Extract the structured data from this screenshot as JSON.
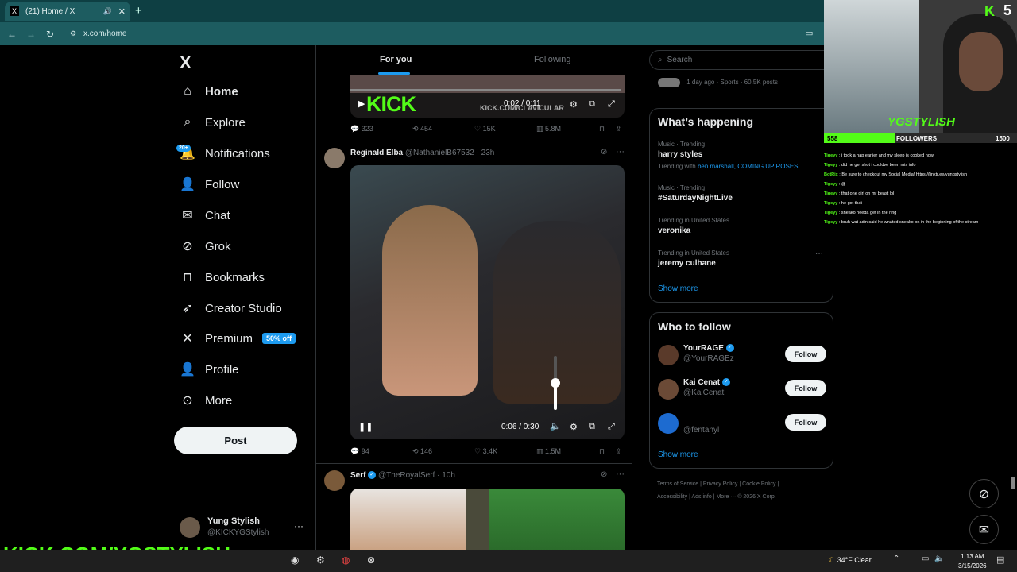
{
  "browser": {
    "tab_title": "(21) Home / X",
    "tab_favicon": "X",
    "url": "x.com/home",
    "new_tab": "+"
  },
  "nav": {
    "logo": "X",
    "items": [
      {
        "label": "Home",
        "icon": "home-icon"
      },
      {
        "label": "Explore",
        "icon": "search-icon"
      },
      {
        "label": "Notifications",
        "icon": "bell-icon",
        "badge": "20+"
      },
      {
        "label": "Follow",
        "icon": "add-person-icon"
      },
      {
        "label": "Chat",
        "icon": "mail-icon"
      },
      {
        "label": "Grok",
        "icon": "grok-icon"
      },
      {
        "label": "Bookmarks",
        "icon": "bookmark-icon"
      },
      {
        "label": "Creator Studio",
        "icon": "rocket-icon"
      },
      {
        "label": "Premium",
        "icon": "x-icon",
        "promo": "50% off"
      },
      {
        "label": "Profile",
        "icon": "person-icon"
      },
      {
        "label": "More",
        "icon": "more-circle-icon"
      }
    ],
    "post_label": "Post",
    "account_name": "Yung Stylish",
    "account_handle": "@KICKYGStylish",
    "account_more": "···"
  },
  "timeline": {
    "tab_for_you": "For you",
    "tab_following": "Following",
    "tweet1": {
      "video_time": "0:02 / 0:11",
      "watermark": "KICK.COM/CLAVICULAR",
      "kick_logo": "KICK",
      "replies": "323",
      "reposts": "454",
      "likes": "15K",
      "views": "5.8M"
    },
    "tweet2": {
      "name": "Reginald Elba",
      "handle": "@NathanielB67532",
      "time": "· 23h",
      "video_time": "0:06 / 0:30",
      "volume": 0.5,
      "replies": "94",
      "reposts": "146",
      "likes": "3.4K",
      "views": "1.5M"
    },
    "tweet3": {
      "name": "Serf",
      "handle": "@TheRoyalSerf",
      "time": "· 10h"
    }
  },
  "sidebar": {
    "search_placeholder": "Search",
    "top_meta": "1 day ago · Sports · 60.5K posts",
    "happening_title": "What’s happening",
    "trends": [
      {
        "meta": "Music · Trending",
        "name": "harry styles",
        "with_label": "Trending with ",
        "with_links": "ben marshall, COMING UP ROSES"
      },
      {
        "meta": "Music · Trending",
        "name": "#SaturdayNightLive"
      },
      {
        "meta": "Trending in United States",
        "name": "veronika"
      },
      {
        "meta": "Trending in United States",
        "name": "jeremy culhane"
      }
    ],
    "show_more": "Show more",
    "who_title": "Who to follow",
    "follow": [
      {
        "name": "YourRAGE",
        "handle": "@YourRAGEz",
        "button": "Follow",
        "color": "#5a3a2a"
      },
      {
        "name": "Kai Cenat",
        "handle": "@KaiCenat",
        "button": "Follow",
        "color": "#6b4a36"
      },
      {
        "name": "",
        "handle": "@fentanyl",
        "button": "Follow",
        "color": "#1d6bd0"
      }
    ],
    "show_more2": "Show more",
    "footer": [
      "Terms of Service",
      "Privacy Policy",
      "Cookie Policy",
      "Accessibility",
      "Ads info",
      "More ···",
      "© 2026 X Corp."
    ]
  },
  "overlay": {
    "kick_count": "5",
    "followers_left": "558",
    "followers_label": "FOLLOWERS",
    "followers_right": "1500",
    "cam_text": "YGSTYLISH",
    "chat": [
      {
        "user": "Tigeyy",
        "msg": "i took a nap earlier and my sleep is cooked now"
      },
      {
        "user": "Tigeyy",
        "msg": "did he get shot i couldve been mis info"
      },
      {
        "user": "BotRix",
        "msg": "Be sure to checkout my Social Media! https://linktr.ee/yungstylish"
      },
      {
        "user": "Tigeyy",
        "msg": "@"
      },
      {
        "user": "Tigeyy",
        "msg": "that one girl on mr beast lol"
      },
      {
        "user": "Tigeyy",
        "msg": "he got that"
      },
      {
        "user": "Tigeyy",
        "msg": "sneako needa get in the ring"
      },
      {
        "user": "Tigeyy",
        "msg": "bruh wat adin said he wnated sneako on in the beginning of the stream"
      }
    ],
    "banner": "KICK.COM/YGSTYLISH"
  },
  "taskbar": {
    "weather": "34°F  Clear",
    "time": "1:13 AM",
    "date": "3/15/2026"
  }
}
